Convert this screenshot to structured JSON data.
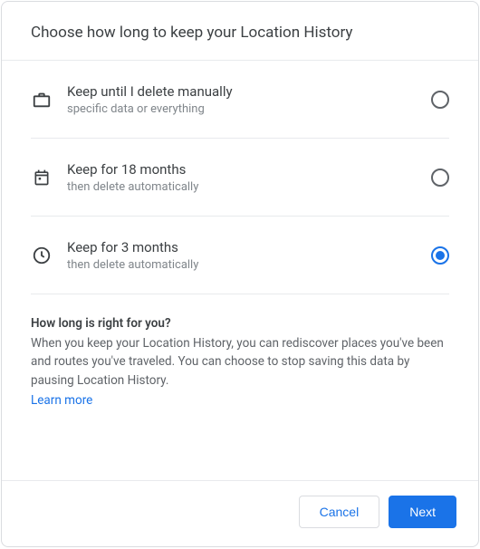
{
  "header": {
    "title": "Choose how long to keep your Location History"
  },
  "options": {
    "manual": {
      "title": "Keep until I delete manually",
      "subtitle": "specific data or everything",
      "selected": false
    },
    "months18": {
      "title": "Keep for 18 months",
      "subtitle": "then delete automatically",
      "selected": false
    },
    "months3": {
      "title": "Keep for 3 months",
      "subtitle": "then delete automatically",
      "selected": true
    }
  },
  "info": {
    "heading": "How long is right for you?",
    "text": "When you keep your Location History, you can rediscover places you've been and routes you've traveled. You can choose to stop saving this data by pausing Location History.",
    "learn_more": "Learn more"
  },
  "footer": {
    "cancel": "Cancel",
    "next": "Next"
  }
}
